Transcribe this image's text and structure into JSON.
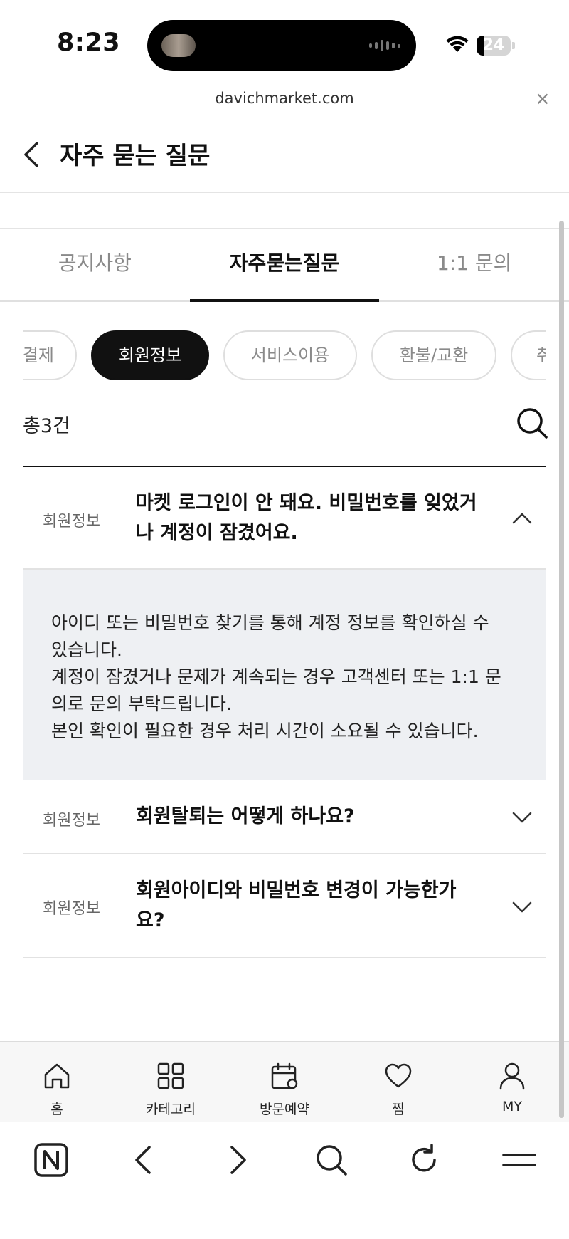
{
  "status_bar": {
    "time": "8:23",
    "battery": "24"
  },
  "url_bar": {
    "domain": "davichmarket.com",
    "close_symbol": "×"
  },
  "header": {
    "title": "자주 묻는 질문",
    "back_icon": "chevron-left-icon"
  },
  "tabs": [
    {
      "label": "공지사항",
      "active": false
    },
    {
      "label": "자주묻는질문",
      "active": true
    },
    {
      "label": "1:1 문의",
      "active": false
    }
  ],
  "chips": [
    {
      "label": "결제",
      "active": false
    },
    {
      "label": "회원정보",
      "active": true
    },
    {
      "label": "서비스이용",
      "active": false
    },
    {
      "label": "환불/교환",
      "active": false
    },
    {
      "label": "취",
      "active": false
    }
  ],
  "count_label": "총3건",
  "search_icon": "search-icon",
  "faqs": [
    {
      "category": "회원정보",
      "question_lines": [
        "마켓 로그인이 안 돼요. 비밀번호를 잊었거",
        "나 계정이 잠겼어요."
      ],
      "expanded": true,
      "answer_lines": [
        "아이디 또는 비밀번호 찾기를 통해 계정 정보를 확인하실 수",
        "있습니다.",
        "계정이 잠겼거나 문제가 계속되는 경우 고객센터 또는 1:1 문",
        "의로 문의 부탁드립니다.",
        "본인 확인이 필요한 경우 처리 시간이 소요될 수 있습니다."
      ]
    },
    {
      "category": "회원정보",
      "question_lines": [
        "회원탈퇴는 어떻게 하나요?"
      ],
      "expanded": false
    },
    {
      "category": "회원정보",
      "question_lines": [
        "회원아이디와 비밀번호 변경이 가능한가",
        "요?"
      ],
      "expanded": false
    }
  ],
  "bottom_nav": [
    {
      "label": "홈",
      "icon": "home-icon"
    },
    {
      "label": "카테고리",
      "icon": "grid-icon"
    },
    {
      "label": "방문예약",
      "icon": "calendar-icon"
    },
    {
      "label": "찜",
      "icon": "heart-icon"
    },
    {
      "label": "MY",
      "icon": "user-icon"
    }
  ],
  "browser_toolbar": {
    "home_letter": "N",
    "icons": [
      "naver-home-icon",
      "back-icon",
      "forward-icon",
      "search-icon",
      "reload-icon",
      "menu-icon"
    ]
  },
  "colors": {
    "accent": "#111111",
    "muted": "#8a8a8a",
    "answer_bg": "#eef0f3",
    "nav_bg": "#f7f7f7"
  }
}
